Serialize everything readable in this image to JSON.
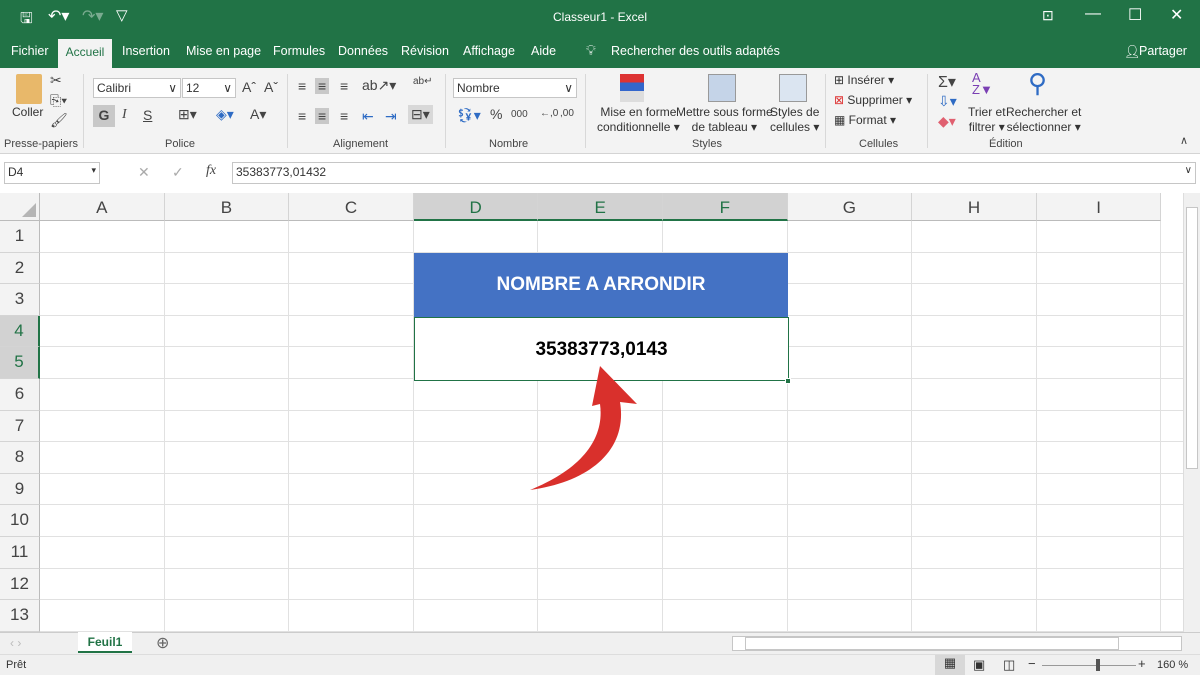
{
  "window": {
    "title": "Classeur1  -  Excel"
  },
  "tabs": [
    "Fichier",
    "Accueil",
    "Insertion",
    "Mise en page",
    "Formules",
    "Données",
    "Révision",
    "Affichage",
    "Aide"
  ],
  "search_tools": "Rechercher des outils adaptés",
  "share": "Partager",
  "ribbon": {
    "paste": "Coller",
    "font_name": "Calibri",
    "font_size": "12",
    "bold": "G",
    "italic": "I",
    "underline": "S",
    "number_format": "Nombre",
    "cond_format": [
      "Mise en forme",
      "conditionnelle ▾"
    ],
    "table_format": [
      "Mettre sous forme",
      "de tableau ▾"
    ],
    "cell_styles": [
      "Styles de",
      "cellules ▾"
    ],
    "insert": "Insérer",
    "delete": "Supprimer",
    "format": "Format",
    "sort": [
      "Trier et",
      "filtrer ▾"
    ],
    "find": [
      "Rechercher et",
      "sélectionner ▾"
    ],
    "groups": [
      "Presse-papiers",
      "Police",
      "Alignement",
      "Nombre",
      "Styles",
      "Cellules",
      "Édition"
    ]
  },
  "formula_bar": {
    "name_box": "D4",
    "fx": "fx",
    "value": "35383773,01432"
  },
  "columns": [
    "A",
    "B",
    "C",
    "D",
    "E",
    "F",
    "G",
    "H",
    "I"
  ],
  "rows": [
    "1",
    "2",
    "3",
    "4",
    "5",
    "6",
    "7",
    "8",
    "9",
    "10",
    "11",
    "12",
    "13"
  ],
  "selected_columns": [
    "D",
    "E",
    "F"
  ],
  "selected_rows": [
    "4",
    "5"
  ],
  "cells": {
    "header": "NOMBRE A ARRONDIR",
    "value": "35383773,0143"
  },
  "colors": {
    "brand": "#217346",
    "header_fill": "#4472C4",
    "arrow": "#D9302C"
  },
  "sheet_tab": "Feuil1",
  "status": {
    "ready": "Prêt",
    "zoom": "160 %",
    "zoom_level_percent": 160
  }
}
